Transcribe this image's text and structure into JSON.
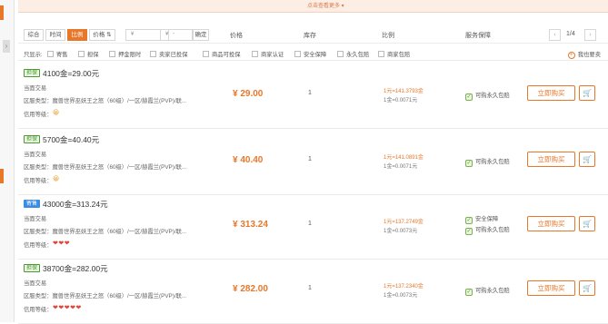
{
  "banner": {
    "text": "点击查看更多 ▾"
  },
  "sort": {
    "comprehensive": "综合",
    "time": "时间",
    "ratio": "比例",
    "price": "价格 ⇅"
  },
  "price_filter": {
    "min_placeholder": "¥",
    "max_placeholder": "¥",
    "confirm": "确定"
  },
  "columns": {
    "price": "价格",
    "stock": "库存",
    "ratio": "比例",
    "service": "服务保障"
  },
  "pager": {
    "prev": "‹",
    "page": "1/4",
    "next": "›"
  },
  "filters": {
    "label": "只显示:",
    "items": [
      "寄售",
      "担保",
      "押金限时",
      "卖家已投保",
      "商品可投保",
      "商家认证",
      "安全保障",
      "永久包赔",
      "商家包赔"
    ],
    "help": "我也要卖"
  },
  "listings": [
    {
      "badge": "担保",
      "badge_style": "green",
      "title": "4100金=29.00元",
      "trade_type": "当面交易",
      "server": "区服类型：魔兽世界巫妖王之怒（60级）/一区/赫霞兰(PVP)/联...",
      "credit_label": "信用等级：",
      "credit_icons": "😀",
      "price": "¥ 29.00",
      "stock": "1",
      "ratio1": "1元=141.3793金",
      "ratio2": "1金=0.0071元",
      "guarantees": [
        "可购永久包赔"
      ],
      "buy": "立即购买",
      "cart_icon": "cart-icon"
    },
    {
      "badge": "担保",
      "badge_style": "green",
      "title": "5700金=40.40元",
      "trade_type": "当面交易",
      "server": "区服类型：魔兽世界巫妖王之怒（60级）/一区/赫霞兰(PVP)/联...",
      "credit_label": "信用等级：",
      "credit_icons": "😀",
      "price": "¥ 40.40",
      "stock": "1",
      "ratio1": "1元=141.0891金",
      "ratio2": "1金=0.0071元",
      "guarantees": [
        "可购永久包赔"
      ],
      "buy": "立即购买",
      "cart_icon": "cart-icon"
    },
    {
      "badge": "寄售",
      "badge_style": "blue",
      "title": "43000金=313.24元",
      "trade_type": "当面交易",
      "server": "区服类型：魔兽世界巫妖王之怒（60级）/一区/赫霞兰(PVP)/联...",
      "credit_label": "信用等级：",
      "credit_icons": "❤❤❤",
      "price": "¥ 313.24",
      "stock": "1",
      "ratio1": "1元=137.2749金",
      "ratio2": "1金=0.0073元",
      "guarantees": [
        "安全保障",
        "可购永久包赔"
      ],
      "buy": "立即购买",
      "cart_icon": "cart-icon"
    },
    {
      "badge": "担保",
      "badge_style": "green",
      "title": "38700金=282.00元",
      "trade_type": "当面交易",
      "server": "区服类型：魔兽世界巫妖王之怒（60级）/一区/赫霞兰(PVP)/联...",
      "credit_label": "信用等级：",
      "credit_icons": "❤❤❤❤❤",
      "price": "¥ 282.00",
      "stock": "1",
      "ratio1": "1元=137.2340金",
      "ratio2": "1金=0.0073元",
      "guarantees": [
        "可购永久包赔"
      ],
      "buy": "立即购买",
      "cart_icon": "cart-icon"
    }
  ],
  "colors": {
    "accent": "#e8772a",
    "guarantee_green": "#4a9a2e",
    "consign_blue": "#3b8de3"
  }
}
